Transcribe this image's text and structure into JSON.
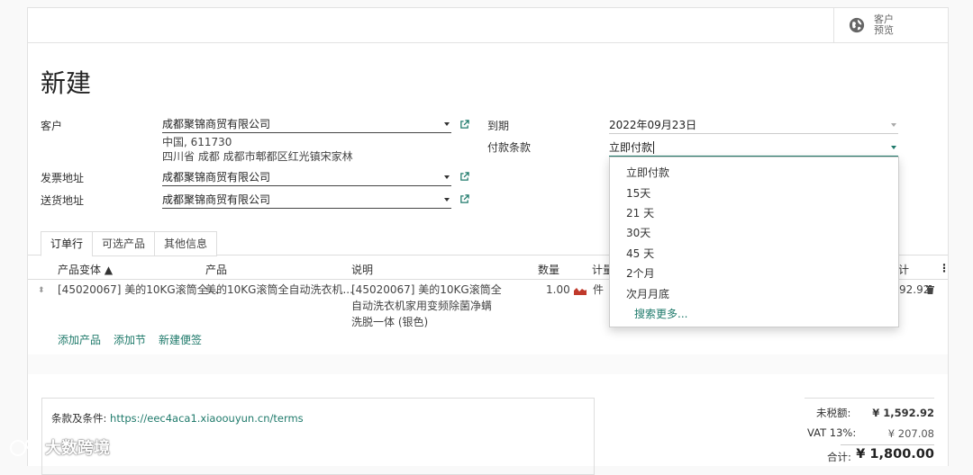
{
  "header": {
    "preview_label_line1": "客户",
    "preview_label_line2": "预览"
  },
  "form": {
    "title": "新建",
    "customer_label": "客户",
    "customer_value": "成都聚锦商贸有限公司",
    "customer_address_line1": "中国, 611730",
    "customer_address_line2": "四川省 成都 成都市郫都区红光镇宋家林",
    "invoice_address_label": "发票地址",
    "invoice_address_value": "成都聚锦商贸有限公司",
    "delivery_address_label": "送货地址",
    "delivery_address_value": "成都聚锦商贸有限公司",
    "expiry_label": "到期",
    "expiry_value": "2022年09月23日",
    "payment_terms_label": "付款条款",
    "payment_terms_value": "立即付款"
  },
  "payment_dropdown": {
    "options": [
      "立即付款",
      "15天",
      "21 天",
      "30天",
      "45 天",
      "2个月",
      "次月月底"
    ],
    "search_more": "搜索更多..."
  },
  "tabs": [
    "订单行",
    "可选产品",
    "其他信息"
  ],
  "order_table": {
    "headers": {
      "variant": "产品变体 ▲",
      "product": "产品",
      "description": "说明",
      "quantity": "数量",
      "uom": "计量",
      "subtotal": "计"
    },
    "rows": [
      {
        "variant": "[45020067] 美的10KG滚筒全...",
        "product": "美的10KG滚筒全自动洗衣机...",
        "description_line1": "[45020067] 美的10KG滚筒全",
        "description_line2": "自动洗衣机家用变频除菌净螨",
        "description_line3": "洗脱一体 (银色)",
        "quantity": "1.00",
        "uom": "件",
        "subtotal": "92.92"
      }
    ],
    "add_product": "添加产品",
    "add_section": "添加节",
    "add_note": "新建便签"
  },
  "terms": {
    "label": "条款及条件: ",
    "url": "https://eec4aca1.xiaoouyun.cn/terms"
  },
  "totals": {
    "untaxed_label": "未税额:",
    "untaxed_value": "¥ 1,592.92",
    "vat_label": "VAT 13%:",
    "vat_value": "¥ 207.08",
    "total_label": "合计:",
    "total_value": "¥ 1,800.00"
  },
  "watermark": {
    "text": "大数跨境"
  },
  "colors": {
    "accent": "#1f7a6b",
    "border": "#dddddd",
    "forecast_icon": "#c0392b"
  }
}
